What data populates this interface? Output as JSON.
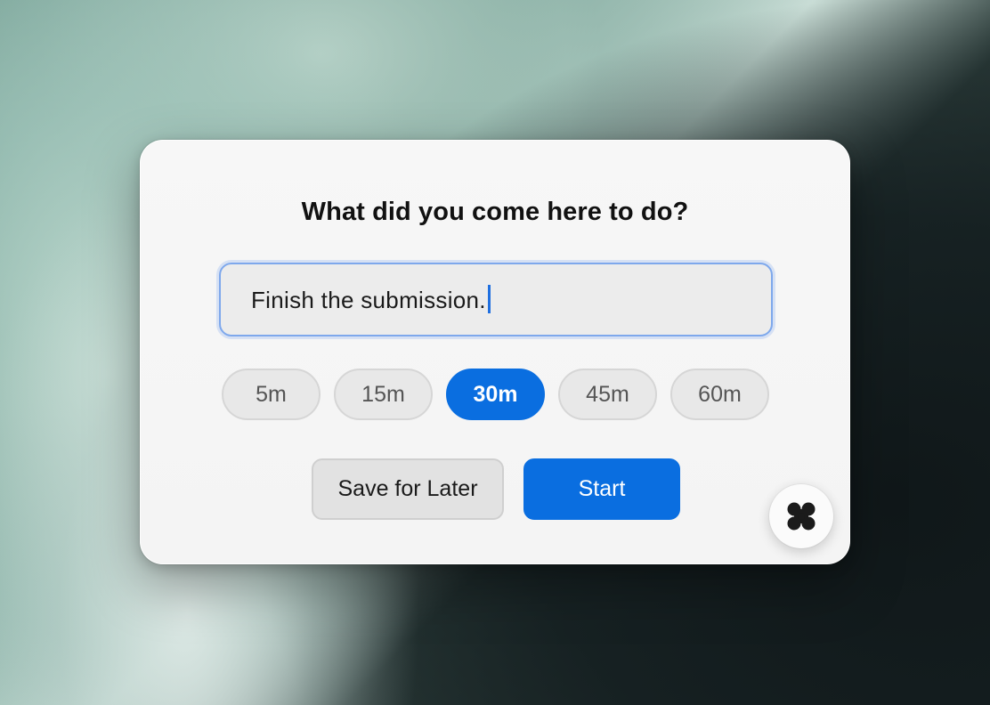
{
  "dialog": {
    "title": "What did you come here to do?",
    "input": {
      "value": "Finish the submission.",
      "focused": true
    },
    "durations": [
      {
        "label": "5m",
        "selected": false
      },
      {
        "label": "15m",
        "selected": false
      },
      {
        "label": "30m",
        "selected": true
      },
      {
        "label": "45m",
        "selected": false
      },
      {
        "label": "60m",
        "selected": false
      }
    ],
    "buttons": {
      "save_later": "Save for Later",
      "start": "Start"
    }
  },
  "app_badge": {
    "icon": "app-logo-icon"
  },
  "colors": {
    "accent": "#0a6ee0",
    "focus_ring": "#7ea8ec",
    "pill_bg": "#e8e8e8",
    "dialog_bg": "#f6f6f6"
  }
}
